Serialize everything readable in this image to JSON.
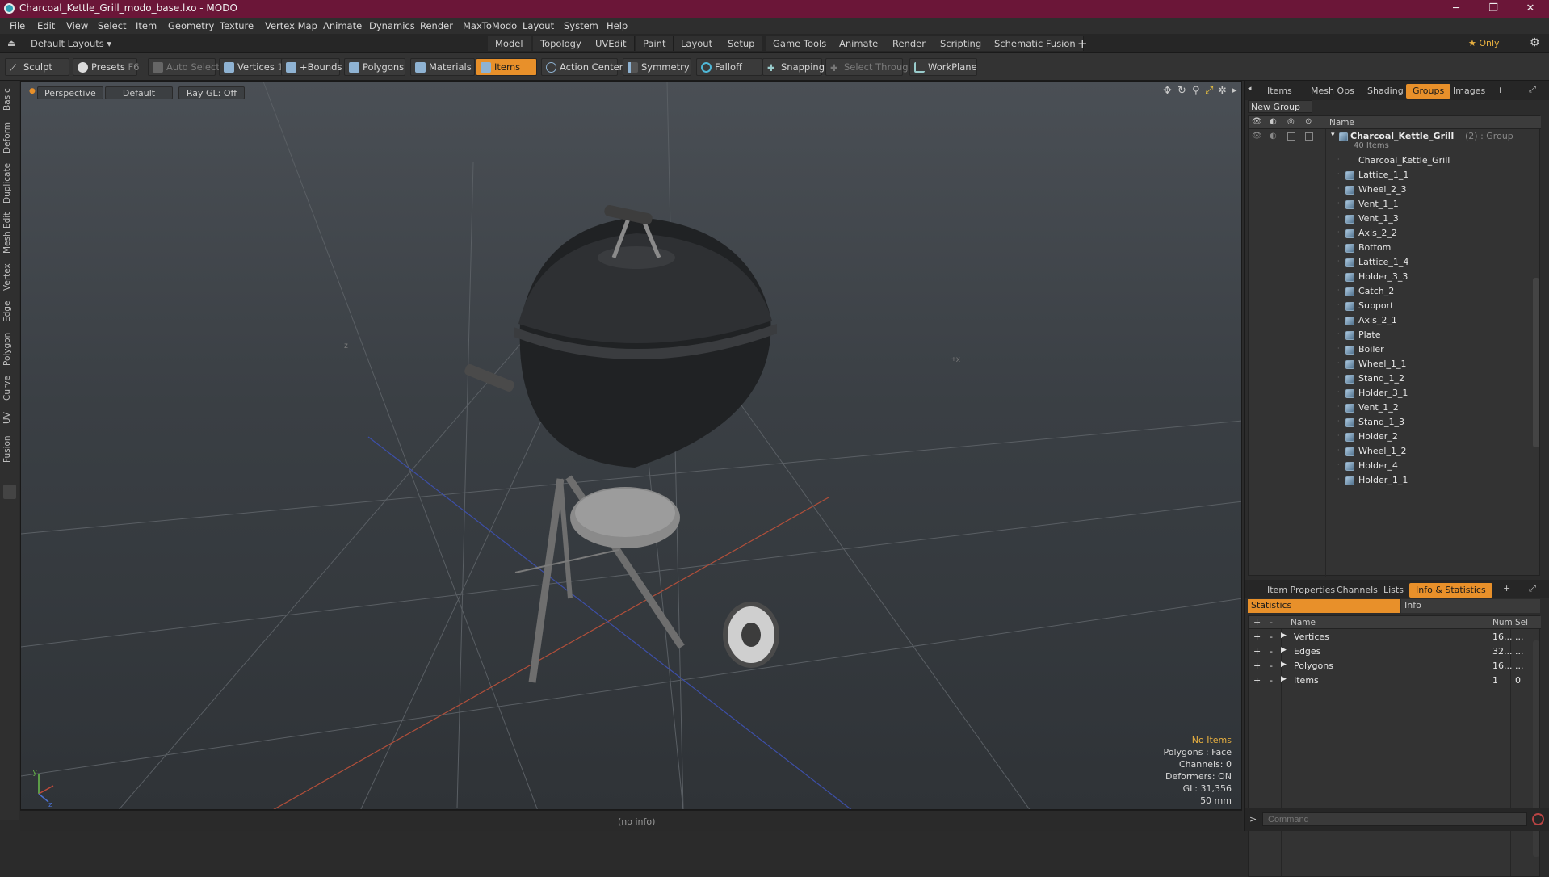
{
  "window": {
    "title": "Charcoal_Kettle_Grill_modo_base.lxo - MODO",
    "minimize": "─",
    "maximize": "❐",
    "close": "✕"
  },
  "menubar": [
    "File",
    "Edit",
    "View",
    "Select",
    "Item",
    "Geometry",
    "Texture",
    "Vertex Map",
    "Animate",
    "Dynamics",
    "Render",
    "MaxToModo",
    "Layout",
    "System",
    "Help"
  ],
  "layoutbar": {
    "layout_dropdown": "Default Layouts ▾",
    "tabs": [
      "Model",
      "Topology",
      "UVEdit",
      "Paint",
      "Layout",
      "Setup",
      "Game Tools",
      "Animate",
      "Render",
      "Scripting",
      "Schematic Fusion"
    ],
    "active_tab": "Model",
    "add": "+",
    "only": "★  Only",
    "gear": "⚙"
  },
  "toolbar": {
    "sculpt": "Sculpt",
    "presets": "Presets",
    "presets_key": "F6",
    "auto_select": "Auto Select",
    "vertices": "Vertices",
    "vertices_count": "1",
    "bounds": "+Bounds",
    "polygons": "Polygons",
    "materials": "Materials",
    "items": "Items",
    "action_center": "Action Center",
    "symmetry": "Symmetry",
    "falloff": "Falloff",
    "snapping": "Snapping",
    "select_through": "Select Through",
    "workplane": "WorkPlane"
  },
  "left_tabs": [
    "Basic",
    "Deform",
    "Duplicate",
    "Mesh Edit",
    "Vertex",
    "Edge",
    "Polygon",
    "Curve",
    "UV",
    "Fusion"
  ],
  "viewport": {
    "view": "Perspective",
    "shading": "Default",
    "raygl": "Ray GL: Off",
    "hud": {
      "no_items": "No Items",
      "polygons": "Polygons : Face",
      "channels": "Channels: 0",
      "deformers": "Deformers: ON",
      "gl": "GL: 31,356",
      "scale": "50 mm"
    },
    "status": "(no info)"
  },
  "colors": {
    "accent": "#e8902a",
    "titlebar": "#6b1638"
  },
  "groups_panel": {
    "tabs": [
      "Items",
      "Mesh Ops",
      "Shading",
      "Groups",
      "Images"
    ],
    "active_tab": "Groups",
    "new_group": "New Group",
    "name_header": "Name",
    "group_name": "Charcoal_Kettle_Grill",
    "group_suffix": "(2) : Group",
    "group_count": "40 Items",
    "items": [
      "Charcoal_Kettle_Grill",
      "Lattice_1_1",
      "Wheel_2_3",
      "Vent_1_1",
      "Vent_1_3",
      "Axis_2_2",
      "Bottom",
      "Lattice_1_4",
      "Holder_3_3",
      "Catch_2",
      "Support",
      "Axis_2_1",
      "Plate",
      "Boiler",
      "Wheel_1_1",
      "Stand_1_2",
      "Holder_3_1",
      "Vent_1_2",
      "Stand_1_3",
      "Holder_2",
      "Wheel_1_2",
      "Holder_4",
      "Holder_1_1"
    ]
  },
  "stats_panel": {
    "tabs": [
      "Item Properties",
      "Channels",
      "Lists",
      "Info & Statistics"
    ],
    "active_tab": "Info & Statistics",
    "subtabs": [
      "Statistics",
      "Info"
    ],
    "headers": {
      "name": "Name",
      "num": "Num",
      "sel": "Sel"
    },
    "rows": [
      {
        "name": "Vertices",
        "num": "16...",
        "sel": "..."
      },
      {
        "name": "Edges",
        "num": "32...",
        "sel": "..."
      },
      {
        "name": "Polygons",
        "num": "16...",
        "sel": "..."
      },
      {
        "name": "Items",
        "num": "1",
        "sel": "0"
      }
    ]
  },
  "command": {
    "prompt": ">",
    "placeholder": "Command"
  }
}
